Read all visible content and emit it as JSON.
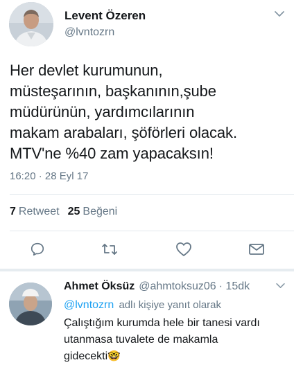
{
  "main_tweet": {
    "author_name": "Levent Özeren",
    "author_handle": "@lvntozrn",
    "text_lines": [
      "Her devlet kurumunun,",
      "müsteşarının, başkanının,şube",
      "müdürünün, yardımcılarının",
      "makam arabaları, şöförleri olacak.",
      "MTV'ne %40 zam yapacaksın!"
    ],
    "timestamp": "16:20 · 28 Eyl 17",
    "stats": {
      "retweet_count": "7",
      "retweet_label": "Retweet",
      "like_count": "25",
      "like_label": "Beğeni"
    }
  },
  "reply_tweet": {
    "author_name": "Ahmet Öksüz",
    "author_handle": "@ahmtoksuz06",
    "time": "· 15dk",
    "reply_to_handle": "@lvntozrn",
    "reply_to_suffix": "adlı kişiye yanıt olarak",
    "text_lines": [
      "Çalıştığım kurumda hele bir tanesi vardı",
      "utanmasa tuvalete de makamla",
      "gidecekti"
    ],
    "emoji": "🤓"
  },
  "icons": {
    "menu": "chevron-down-icon",
    "reply": "comment-icon",
    "retweet": "retweet-icon",
    "like": "heart-icon",
    "share": "envelope-icon"
  },
  "colors": {
    "link": "#1da1f2",
    "secondary_text": "#657786",
    "divider": "#e1e8ed"
  }
}
